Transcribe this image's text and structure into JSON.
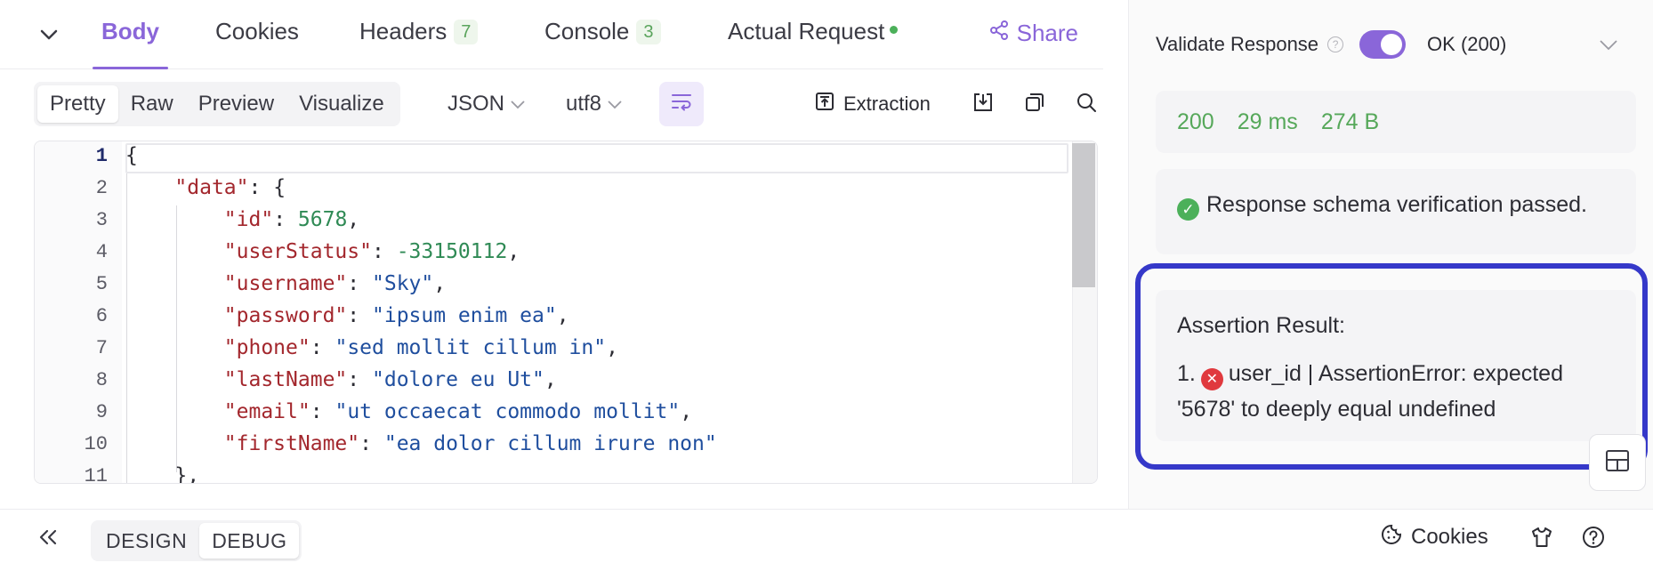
{
  "tabs": {
    "items": [
      {
        "label": "Body",
        "count": null
      },
      {
        "label": "Cookies",
        "count": null
      },
      {
        "label": "Headers",
        "count": "7"
      },
      {
        "label": "Console",
        "count": "3"
      },
      {
        "label": "Actual Request",
        "count": null
      }
    ],
    "active": "Body",
    "share_label": "Share"
  },
  "toolbar": {
    "views": [
      "Pretty",
      "Raw",
      "Preview",
      "Visualize"
    ],
    "active_view": "Pretty",
    "format": "JSON",
    "encoding": "utf8",
    "extraction_label": "Extraction"
  },
  "editor": {
    "line_numbers": [
      "1",
      "2",
      "3",
      "4",
      "5",
      "6",
      "7",
      "8",
      "9",
      "10",
      "11"
    ],
    "lines": [
      {
        "text": "{"
      },
      {
        "key": "data",
        "tail": ": {"
      },
      {
        "key": "id",
        "num": "5678",
        "tail": ","
      },
      {
        "key": "userStatus",
        "num": "-33150112",
        "tail": ","
      },
      {
        "key": "username",
        "str": "Sky",
        "tail": ","
      },
      {
        "key": "password",
        "str": "ipsum enim ea",
        "tail": ","
      },
      {
        "key": "phone",
        "str": "sed mollit cillum in",
        "tail": ","
      },
      {
        "key": "lastName",
        "str": "dolore eu Ut",
        "tail": ","
      },
      {
        "key": "email",
        "str": "ut occaecat commodo mollit",
        "tail": ","
      },
      {
        "key": "firstName",
        "str": "ea dolor cillum irure non",
        "tail": ""
      },
      {
        "text": "},"
      }
    ]
  },
  "validate": {
    "label": "Validate Response",
    "help": "?",
    "enabled": true,
    "status_option": "OK (200)"
  },
  "stats": {
    "status": "200",
    "time": "29 ms",
    "size": "274 B"
  },
  "schema": {
    "message": "Response schema verification passed."
  },
  "assertion": {
    "title": "Assertion Result:",
    "items": [
      {
        "index": "1.",
        "text": "user_id | AssertionError: expected '5678' to deeply equal undefined"
      }
    ]
  },
  "footer": {
    "modes": [
      "DESIGN",
      "DEBUG"
    ],
    "active_mode": "DEBUG",
    "cookies_label": "Cookies"
  },
  "colors": {
    "accent": "#8a66d9",
    "success": "#4cb05a",
    "error": "#e0393e",
    "highlight": "#3538c9"
  },
  "icons": {
    "collapse": "chevron-down-icon",
    "share": "share-icon",
    "wrap": "wrap-lines-icon",
    "extraction": "extraction-icon",
    "download": "download-icon",
    "copy": "copy-icon",
    "search": "search-icon",
    "back": "double-chevron-left-icon",
    "cookie": "cookie-icon",
    "shirt": "shirt-icon",
    "help": "help-circle-icon",
    "layout": "layout-panel-icon"
  }
}
